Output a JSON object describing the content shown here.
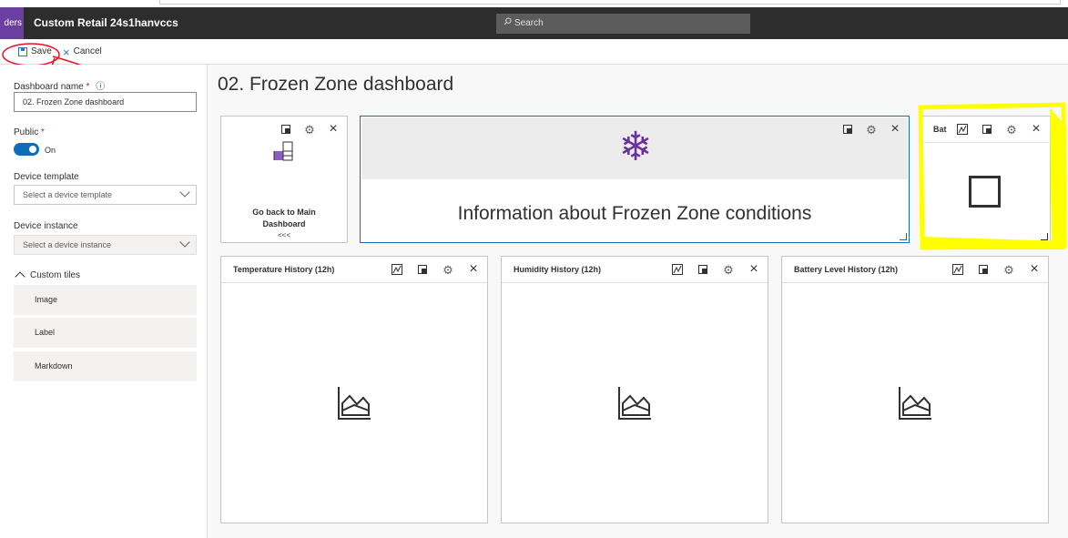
{
  "header": {
    "app_badge": "ders",
    "app_title": "Custom Retail 24s1hanvccs",
    "search_placeholder": "Search"
  },
  "commandbar": {
    "save_label": "Save",
    "cancel_label": "Cancel"
  },
  "sidebar": {
    "dashboard_name_label": "Dashboard name",
    "dashboard_name_required": "*",
    "dashboard_name_value": "02. Frozen Zone dashboard",
    "public_label": "Public",
    "public_required": "*",
    "public_toggle_text": "On",
    "device_template_label": "Device template",
    "device_template_placeholder": "Select a device template",
    "device_instance_label": "Device instance",
    "device_instance_placeholder": "Select a device instance",
    "custom_tiles_label": "Custom tiles",
    "custom_tiles": [
      "Image",
      "Label",
      "Markdown"
    ]
  },
  "main": {
    "page_title": "02. Frozen Zone dashboard",
    "tiles": {
      "goback": {
        "text_line1": "Go back to Main",
        "text_line2": "Dashboard",
        "arrows": "<<<"
      },
      "info": {
        "text": "Information about Frozen Zone conditions"
      },
      "battery_small": {
        "title": "Bat"
      },
      "temperature": {
        "title": "Temperature History (12h)"
      },
      "humidity": {
        "title": "Humidity History (12h)"
      },
      "battery": {
        "title": "Battery Level History (12h)"
      }
    }
  },
  "colors": {
    "accent": "#0f6cbd",
    "brand_purple": "#6b2fa0",
    "highlight_yellow": "#ffff00",
    "annotation_red": "#e81123"
  }
}
